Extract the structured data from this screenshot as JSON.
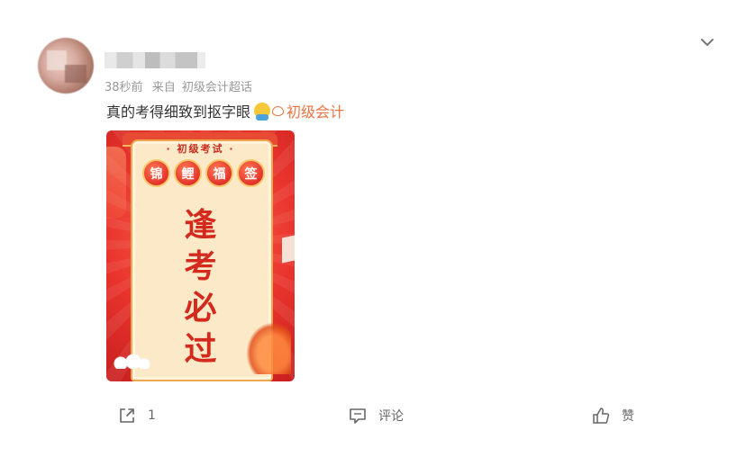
{
  "post": {
    "time": "38秒前",
    "source_prefix": "来自",
    "source": "初级会计超话",
    "text": "真的考得细致到抠字眼",
    "topic": "初级会计"
  },
  "card": {
    "subtitle": "· 初级考试 ·",
    "badges": [
      "锦",
      "鲤",
      "福",
      "签"
    ],
    "lines": [
      "逢",
      "考",
      "必",
      "过"
    ]
  },
  "actions": {
    "repost_count": "1",
    "comment_label": "评论",
    "like_label": "赞"
  },
  "icons": {
    "menu": "chevron-down-icon",
    "repost": "share-icon",
    "comment": "comment-icon",
    "like": "thumbs-up-icon",
    "topic": "topic-icon"
  },
  "colors": {
    "topic": "#eb7340",
    "card_red": "#e8332c",
    "meta": "#999999"
  }
}
